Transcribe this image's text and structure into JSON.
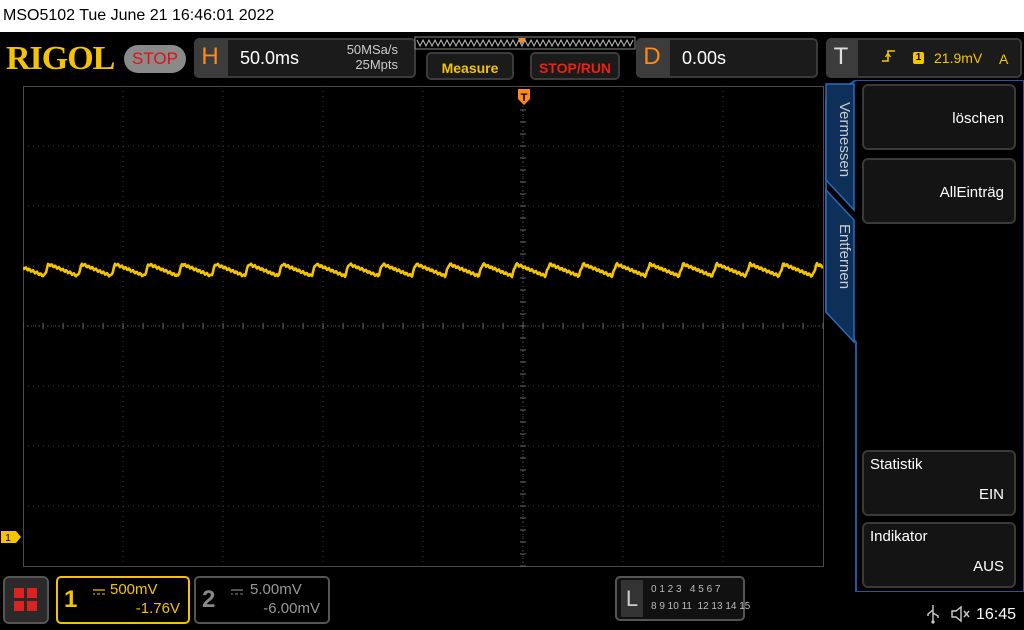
{
  "status_bar": {
    "text": "MSO5102  Tue June 21 16:46:01 2022"
  },
  "brand": "RIGOL",
  "run_state": "STOP",
  "horizontal": {
    "letter": "H",
    "timebase": "50.0ms",
    "sample_rate": "50MSa/s",
    "memory_depth": "25Mpts"
  },
  "buttons": {
    "measure": "Measure",
    "stop_run": "STOP/RUN"
  },
  "delay": {
    "letter": "D",
    "value": "0.00s"
  },
  "trigger": {
    "letter": "T",
    "source_badge": "1",
    "level": "21.9mV",
    "mode": "A",
    "marker": "T",
    "icon": "rising-edge-icon"
  },
  "side_tabs": {
    "tab1": "Vermessen",
    "tab2": "Entfernen"
  },
  "softkeys": {
    "clear": "löschen",
    "all_entries": "AllEinträg",
    "statistics": {
      "title": "Statistik",
      "value": "EIN"
    },
    "indicator": {
      "title": "Indikator",
      "value": "AUS"
    }
  },
  "channels": {
    "ch1": {
      "number": "1",
      "scale": "500mV",
      "offset": "-1.76V",
      "color": "#f5c400"
    },
    "ch2": {
      "number": "2",
      "scale": "5.00mV",
      "offset": "-6.00mV",
      "color": "#777777"
    }
  },
  "logic_analyzer": {
    "letter": "L",
    "row1": "0 1 2 3   4 5 6 7",
    "row2": "8 9 10 11  12 13 14 15"
  },
  "clock": "16:45",
  "ch1_ground_marker": "1",
  "colors": {
    "accent": "#f5c400",
    "orange": "#ff8a1a",
    "stop_red": "#dd1111",
    "panel_blue": "#1f5aa0"
  }
}
